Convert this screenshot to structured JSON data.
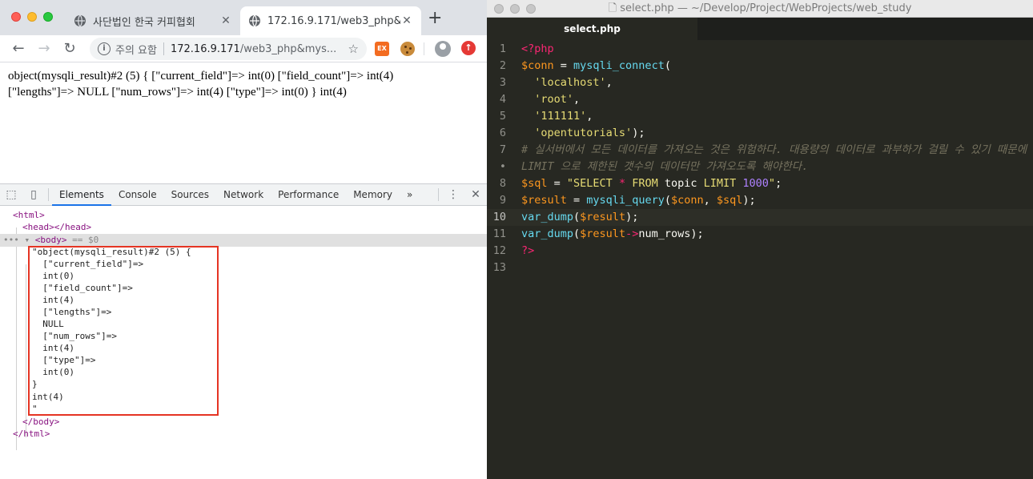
{
  "browser": {
    "tabs": [
      {
        "title": "사단법인 한국 커피협회",
        "active": false
      },
      {
        "title": "172.16.9.171/web3_php&mysql",
        "active": true
      }
    ],
    "address": {
      "warning": "주의 요함",
      "host": "172.16.9.171",
      "path": "/web3_php&mys..."
    },
    "page_output": [
      "object(mysqli_result)#2 (5) { [\"current_field\"]=> int(0) [\"field_count\"]=> int(4)",
      "[\"lengths\"]=> NULL [\"num_rows\"]=> int(4) [\"type\"]=> int(0) } int(4)"
    ]
  },
  "devtools": {
    "tabs": [
      "Elements",
      "Console",
      "Sources",
      "Network",
      "Performance",
      "Memory"
    ],
    "active_tab": "Elements",
    "more": "»",
    "dom": {
      "html_open": "<html>",
      "head": "<head></head>",
      "body_open": "<body>",
      "body_eq": " == $0",
      "lines": [
        "\"object(mysqli_result)#2 (5) {",
        "  [\"current_field\"]=>",
        "  int(0)",
        "  [\"field_count\"]=>",
        "  int(4)",
        "  [\"lengths\"]=>",
        "  NULL",
        "  [\"num_rows\"]=>",
        "  int(4)",
        "  [\"type\"]=>",
        "  int(0)",
        "}",
        "int(4)",
        "\""
      ],
      "body_close": "</body>",
      "html_close": "</html>"
    }
  },
  "editor": {
    "window_title": "select.php — ~/Develop/Project/WebProjects/web_study",
    "tab": "select.php",
    "current_line": 10,
    "lines": [
      {
        "n": "1",
        "tokens": [
          {
            "c": "t-tag",
            "t": "<?php"
          }
        ]
      },
      {
        "n": "2",
        "tokens": [
          {
            "c": "t-var",
            "t": "$conn"
          },
          {
            "c": "t-op",
            "t": " = "
          },
          {
            "c": "t-fn",
            "t": "mysqli_connect"
          },
          {
            "c": "t-op",
            "t": "("
          }
        ]
      },
      {
        "n": "3",
        "tokens": [
          {
            "c": "t-op",
            "t": "  "
          },
          {
            "c": "t-str",
            "t": "'localhost'"
          },
          {
            "c": "t-op",
            "t": ","
          }
        ]
      },
      {
        "n": "4",
        "tokens": [
          {
            "c": "t-op",
            "t": "  "
          },
          {
            "c": "t-str",
            "t": "'root'"
          },
          {
            "c": "t-op",
            "t": ","
          }
        ]
      },
      {
        "n": "5",
        "tokens": [
          {
            "c": "t-op",
            "t": "  "
          },
          {
            "c": "t-str",
            "t": "'111111'"
          },
          {
            "c": "t-op",
            "t": ","
          }
        ]
      },
      {
        "n": "6",
        "tokens": [
          {
            "c": "t-op",
            "t": "  "
          },
          {
            "c": "t-str",
            "t": "'opentutorials'"
          },
          {
            "c": "t-op",
            "t": ");"
          }
        ]
      },
      {
        "n": "7",
        "tokens": [
          {
            "c": "t-cm",
            "t": "# 실서버에서 모든 데이터를 가져오는 것은 위험하다. 대용량의 데이터로 과부하가 걸릴 수 있기 때문에"
          }
        ]
      },
      {
        "n": "•",
        "tokens": [
          {
            "c": "t-cm",
            "t": "LIMIT 으로 제한된 갯수의 데이터만 가져오도록 해야한다."
          }
        ]
      },
      {
        "n": "8",
        "tokens": [
          {
            "c": "t-var",
            "t": "$sql"
          },
          {
            "c": "t-op",
            "t": " = "
          },
          {
            "c": "t-str",
            "t": "\"SELECT "
          },
          {
            "c": "t-tag",
            "t": "*"
          },
          {
            "c": "t-str",
            "t": " FROM "
          },
          {
            "c": "t-op",
            "t": "topic"
          },
          {
            "c": "t-str",
            "t": " LIMIT "
          },
          {
            "c": "t-kw",
            "t": "1000"
          },
          {
            "c": "t-str",
            "t": "\""
          },
          {
            "c": "t-op",
            "t": ";"
          }
        ]
      },
      {
        "n": "9",
        "tokens": [
          {
            "c": "t-var",
            "t": "$result"
          },
          {
            "c": "t-op",
            "t": " = "
          },
          {
            "c": "t-fn",
            "t": "mysqli_query"
          },
          {
            "c": "t-op",
            "t": "("
          },
          {
            "c": "t-var",
            "t": "$conn"
          },
          {
            "c": "t-op",
            "t": ", "
          },
          {
            "c": "t-var",
            "t": "$sql"
          },
          {
            "c": "t-op",
            "t": ");"
          }
        ]
      },
      {
        "n": "10",
        "tokens": [
          {
            "c": "t-fn",
            "t": "var_dump"
          },
          {
            "c": "t-op",
            "t": "("
          },
          {
            "c": "t-var",
            "t": "$result"
          },
          {
            "c": "t-op",
            "t": ");"
          }
        ]
      },
      {
        "n": "11",
        "tokens": [
          {
            "c": "t-fn",
            "t": "var_dump"
          },
          {
            "c": "t-op",
            "t": "("
          },
          {
            "c": "t-var",
            "t": "$result"
          },
          {
            "c": "t-tag",
            "t": "->"
          },
          {
            "c": "t-op",
            "t": "num_rows);"
          }
        ]
      },
      {
        "n": "12",
        "tokens": [
          {
            "c": "t-tag",
            "t": "?>"
          }
        ]
      },
      {
        "n": "13",
        "tokens": []
      }
    ]
  }
}
